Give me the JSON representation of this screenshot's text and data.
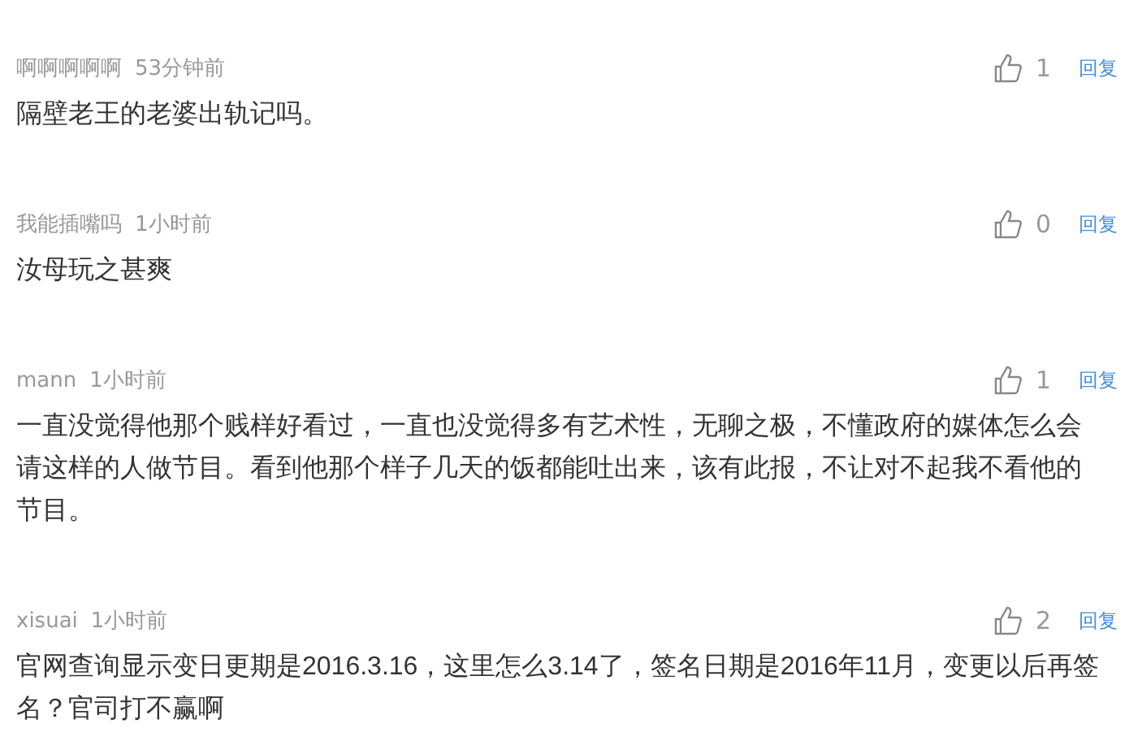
{
  "comments": [
    {
      "user": "啊啊啊啊啊",
      "time": "53分钟前",
      "likes": "1",
      "reply": "回复",
      "text": "隔壁老王的老婆出轨记吗。"
    },
    {
      "user": "我能插嘴吗",
      "time": "1小时前",
      "likes": "0",
      "reply": "回复",
      "text": "汝母玩之甚爽"
    },
    {
      "user": "mann",
      "time": "1小时前",
      "likes": "1",
      "reply": "回复",
      "text": "一直没觉得他那个贱样好看过，一直也没觉得多有艺术性，无聊之极，不懂政府的媒体怎么会请这样的人做节目。看到他那个样子几天的饭都能吐出来，该有此报，不让对不起我不看他的节目。"
    },
    {
      "user": "xisuai",
      "time": "1小时前",
      "likes": "2",
      "reply": "回复",
      "text": "官网查询显示变日更期是2016.3.16，这里怎么3.14了，签名日期是2016年11月，变更以后再签名？官司打不赢啊"
    }
  ]
}
